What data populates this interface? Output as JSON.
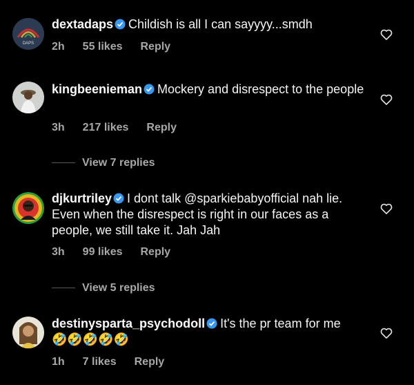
{
  "comments": [
    {
      "username": "dextadaps",
      "text": "Childish is all I can sayyyy...smdh",
      "time": "2h",
      "likes": "55 likes",
      "reply": "Reply",
      "avatar_text": "DAPS"
    },
    {
      "username": "kingbeenieman",
      "text": "Mockery and disrespect to the people",
      "time": "3h",
      "likes": "217 likes",
      "reply": "Reply",
      "view_replies": "View 7 replies"
    },
    {
      "username": "djkurtriley",
      "text": "I dont talk @sparkiebabyofficial nah lie. Even when the disrespect is right in our faces as a people, we still take it. Jah Jah",
      "time": "3h",
      "likes": "99 likes",
      "reply": "Reply",
      "view_replies": "View 5 replies"
    },
    {
      "username": "destinysparta_psychodoll",
      "text": "It's the pr team for me",
      "emoji": "🤣🤣🤣🤣🤣",
      "time": "1h",
      "likes": "7 likes",
      "reply": "Reply"
    }
  ],
  "colors": {
    "background": "#000000",
    "verified": "#3897f0",
    "secondary_text": "#a8a8a8"
  },
  "icons": [
    "verified-badge-icon",
    "heart-icon"
  ]
}
